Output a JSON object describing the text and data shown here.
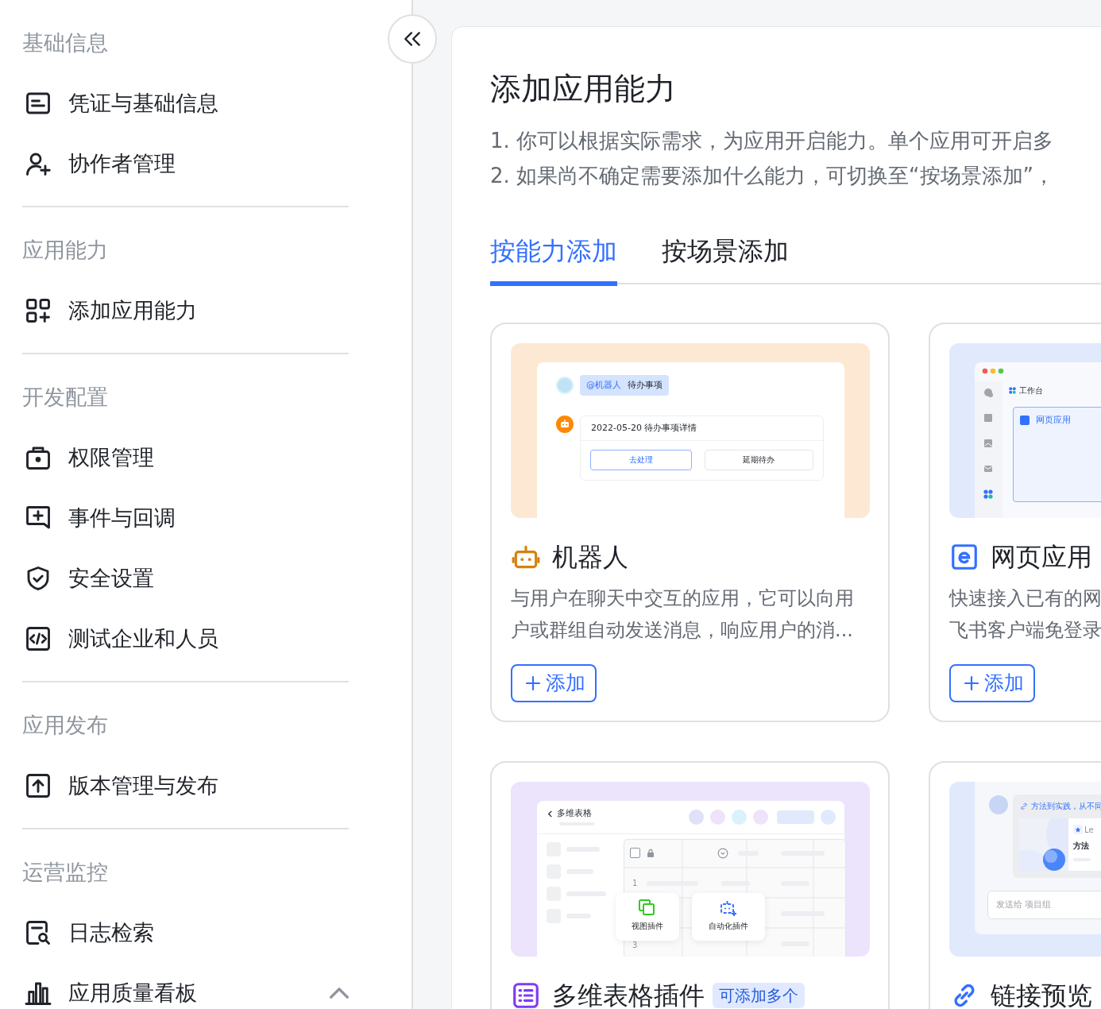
{
  "sidebar": {
    "sections": [
      {
        "heading": "基础信息",
        "items": [
          {
            "label": "凭证与基础信息",
            "kind": "credential",
            "selected": false
          },
          {
            "label": "协作者管理",
            "kind": "collaborator",
            "selected": false
          }
        ]
      },
      {
        "heading": "应用能力",
        "items": [
          {
            "label": "添加应用能力",
            "kind": "apps",
            "selected": false
          }
        ]
      },
      {
        "heading": "开发配置",
        "items": [
          {
            "label": "权限管理",
            "kind": "permission",
            "selected": false
          },
          {
            "label": "事件与回调",
            "kind": "event",
            "selected": false
          },
          {
            "label": "安全设置",
            "kind": "shield",
            "selected": false
          },
          {
            "label": "测试企业和人员",
            "kind": "test",
            "selected": false
          }
        ]
      },
      {
        "heading": "应用发布",
        "items": [
          {
            "label": "版本管理与发布",
            "kind": "upload",
            "selected": false
          }
        ]
      },
      {
        "heading": "运营监控",
        "items": [
          {
            "label": "日志检索",
            "kind": "log",
            "selected": false
          },
          {
            "label": "应用质量看板",
            "kind": "chart",
            "selected": false,
            "expanded": true
          }
        ]
      }
    ]
  },
  "main": {
    "title": "添加应用能力",
    "notes": [
      "1. 你可以根据实际需求，为应用开启能力。单个应用可开启多",
      "2. 如果尚不确定需要添加什么能力，可切换至“按场景添加”，"
    ],
    "tabs": [
      {
        "label": "按能力添加",
        "selected": true
      },
      {
        "label": "按场景添加",
        "selected": false
      }
    ],
    "cards": [
      {
        "kind": "bot",
        "title": "机器人",
        "description_lines": [
          "与用户在聊天中交互的应用，它可以向用",
          "户或群组自动发送消息，响应用户的消..."
        ],
        "button": "添加",
        "preview": {
          "kind": "bot",
          "mention": "@机器人",
          "message": "待办事项",
          "card_title": "2022-05-20 待办事项详情",
          "primary_action": "去处理",
          "secondary_action": "延期待办"
        }
      },
      {
        "kind": "web",
        "title": "网页应用",
        "description_lines": [
          "快速接入已有的网",
          "飞书客户端免登录"
        ],
        "button": "添加",
        "preview": {
          "kind": "web",
          "tab": "工作台",
          "panel_title": "网页应用"
        }
      },
      {
        "kind": "bitable",
        "title": "多维表格插件",
        "badge": "可添加多个",
        "preview": {
          "kind": "bitable",
          "header": "多维表格",
          "checkbox_checked": false,
          "row_numbers": [
            "1",
            "3"
          ],
          "plugins": [
            "视图插件",
            "自动化插件"
          ]
        }
      },
      {
        "kind": "link",
        "title": "链接预览",
        "preview": {
          "kind": "link",
          "link_text": "方法到实践，从不同",
          "card_label": "Le",
          "card_title": "方法",
          "input_placeholder": "发送给 项目组"
        }
      }
    ]
  }
}
